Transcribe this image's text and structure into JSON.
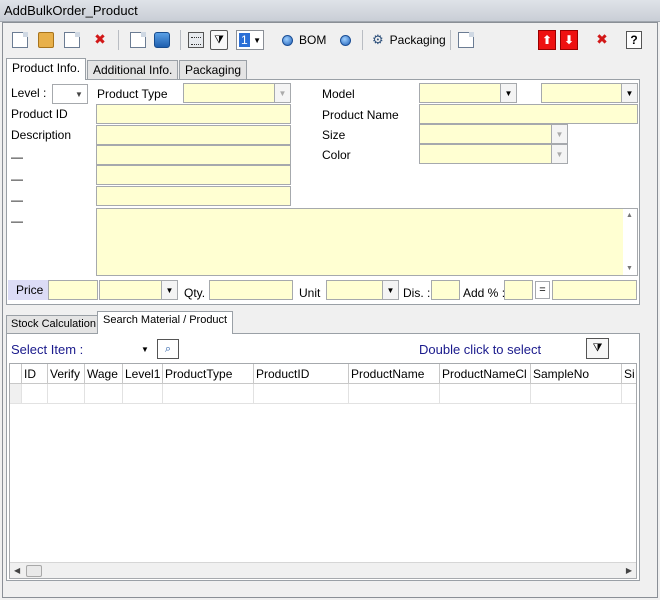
{
  "window": {
    "title": "AddBulkOrder_Product"
  },
  "toolbar": {
    "spin_value": "1",
    "bom_label": "BOM",
    "packaging_label": "Packaging"
  },
  "top_tabs": [
    "Product Info.",
    "Additional Info.",
    "Packaging"
  ],
  "product_info": {
    "level_label": "Level :",
    "product_type_label": "Product Type",
    "model_label": "Model",
    "product_id_label": "Product ID",
    "product_name_label": "Product Name",
    "description_label": "Description",
    "size_label": "Size",
    "color_label": "Color",
    "dash_labels": [
      "—",
      "—",
      "—",
      "—"
    ],
    "price_label": "Price",
    "qty_label": "Qty.",
    "unit_label": "Unit",
    "dis_label": "Dis. :",
    "add_label": "Add % :",
    "equals_label": "="
  },
  "bottom_tabs": [
    "Stock Calculation",
    "Search Material / Product"
  ],
  "search": {
    "select_item_label": "Select Item :",
    "hint": "Double click to select"
  },
  "grid": {
    "columns": [
      "ID",
      "Verify",
      "Wage",
      "Level1",
      "ProductType",
      "ProductID",
      "ProductName",
      "ProductNameCl",
      "SampleNo",
      "Si"
    ]
  },
  "colors": {
    "field_bg": "#ffffd2",
    "hint_color": "#1a1a8c",
    "select_color": "#1a1a8c"
  }
}
